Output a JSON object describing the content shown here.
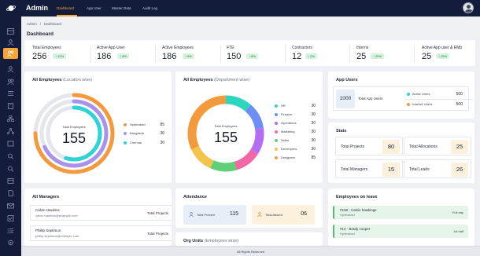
{
  "app": {
    "title": "Admin"
  },
  "nav": {
    "items": [
      "Dashboard",
      "App User",
      "Master Data",
      "Audit Log"
    ],
    "active_index": 0
  },
  "colors": {
    "accent": "#f5a53a",
    "sidebar": "#131c3a",
    "badge_green": "#d7f2e1"
  },
  "breadcrumb": {
    "root": "Admin",
    "separator": "/",
    "current": "Dashboard"
  },
  "page": {
    "title": "Dashboard"
  },
  "stats": [
    {
      "label": "Total Employees",
      "value": "256",
      "badge": "12%"
    },
    {
      "label": "Active App User",
      "value": "186",
      "badge": "8%"
    },
    {
      "label": "Active Employees",
      "value": "186",
      "badge": "8%"
    },
    {
      "label": "FTE",
      "value": "150",
      "badge": "8%"
    },
    {
      "label": "Contractors",
      "value": "12",
      "badge": "2%"
    },
    {
      "label": "Interns",
      "value": "25",
      "badge": "25%"
    },
    {
      "label": "Active App user & EMp",
      "value": "25",
      "badge": "25%"
    }
  ],
  "location_card": {
    "title": "All Employees",
    "subtitle": "(Location wise)",
    "center_label": "Total Employees",
    "center_value": "155",
    "legend": [
      {
        "name": "Hyderabad",
        "value": "85",
        "color": "#f39a3c"
      },
      {
        "name": "Bangalore",
        "value": "30",
        "color": "#a992ec"
      },
      {
        "name": "Chennai",
        "value": "30",
        "color": "#2ed3d6"
      }
    ]
  },
  "department_card": {
    "title": "All Employees",
    "subtitle": "(Department wise)",
    "center_label": "Total Employees",
    "center_value": "155",
    "legend": [
      {
        "name": "HR",
        "value": "30",
        "color": "#2dd7be"
      },
      {
        "name": "Finance",
        "value": "30",
        "color": "#6c8ef5"
      },
      {
        "name": "Operations",
        "value": "30",
        "color": "#b56df2"
      },
      {
        "name": "Marketing",
        "value": "30",
        "color": "#f268a6"
      },
      {
        "name": "Sales",
        "value": "30",
        "color": "#5fd078"
      },
      {
        "name": "Developers",
        "value": "30",
        "color": "#f4c34b"
      },
      {
        "name": "Designers",
        "value": "85",
        "color": "#f39a3c"
      }
    ]
  },
  "app_users": {
    "title": "App Users",
    "total": "1000",
    "total_label": "Total App Users",
    "active_label": "Active Users",
    "active_value": "500",
    "active_color": "#2ed3d6",
    "inactive_label": "Inactive Users",
    "inactive_value": "500",
    "inactive_color": "#f39a3c"
  },
  "stats_card": {
    "title": "Stats",
    "items": [
      {
        "label": "Total Projects",
        "value": "80"
      },
      {
        "label": "Total Allocations",
        "value": "25"
      },
      {
        "label": "Total Managers",
        "value": "15"
      },
      {
        "label": "Total Leads",
        "value": "26"
      }
    ]
  },
  "managers": {
    "title": "All Managers",
    "project_label": "Total Projects",
    "rows": [
      {
        "name": "Calvin Hawkins",
        "email": "calvin.hawkins@example.com",
        "projects": "15"
      },
      {
        "name": "Phillip Septimus",
        "email": "phillip.septimus@example.com",
        "projects": "10"
      }
    ]
  },
  "attendance": {
    "title": "Attendance",
    "present_label": "Total Present",
    "present_value": "115",
    "absent_label": "Total Absent",
    "absent_value": "06"
  },
  "org_units": {
    "title": "Org Units",
    "subtitle": "(Employees wise)"
  },
  "leave": {
    "title": "Employees on leave",
    "rows": [
      {
        "name": "#108 - Calvin hawkings",
        "location": "Hyderabad",
        "duration": "Full day"
      },
      {
        "name": "#14 - Brady cooper",
        "location": "Hyderabad",
        "duration": "1st half"
      }
    ]
  },
  "footer": {
    "text": "All Rights Reserved"
  },
  "sidebar": {
    "icons": [
      "dashboard-icon",
      "user-icon",
      "users-icon",
      "person-icon",
      "group-icon",
      "list-icon",
      "building-icon",
      "hierarchy-icon",
      "network-icon",
      "box-icon",
      "search-icon",
      "search-list-icon",
      "calendar-icon",
      "document-icon",
      "mail-icon",
      "task-icon",
      "list-check-icon",
      "settings-icon"
    ],
    "active_index": 2
  }
}
